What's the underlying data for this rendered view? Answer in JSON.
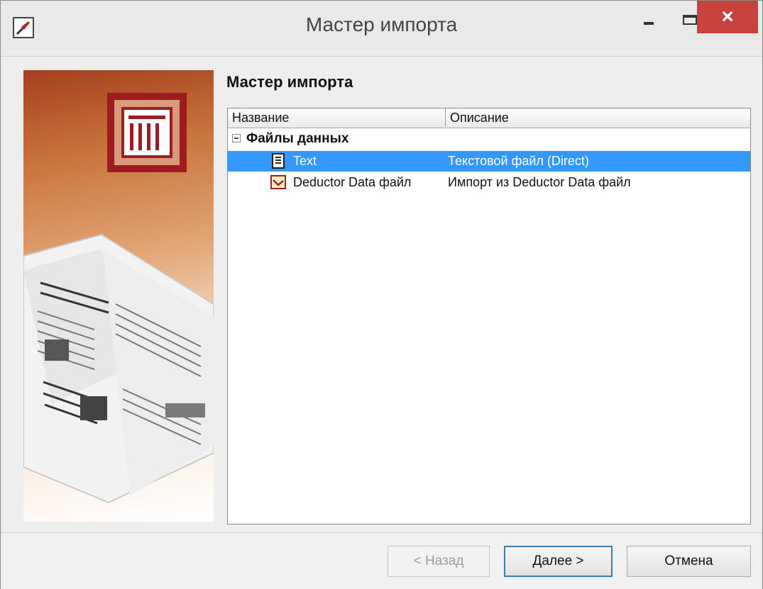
{
  "window": {
    "title": "Мастер импорта",
    "close_glyph": "×"
  },
  "panel": {
    "heading": "Мастер импорта"
  },
  "list": {
    "columns": [
      "Название",
      "Описание"
    ],
    "group": {
      "label": "Файлы данных",
      "expanded": true
    },
    "rows": [
      {
        "name": "Text",
        "description": "Текстовой файл (Direct)",
        "icon": "text-file-icon",
        "selected": true
      },
      {
        "name": "Deductor Data файл",
        "description": "Импорт из Deductor Data файл",
        "icon": "deductor-data-icon",
        "selected": false
      }
    ]
  },
  "buttons": {
    "back": "< Назад",
    "next": "Далее >",
    "cancel": "Отмена"
  },
  "colors": {
    "selection": "#3399ff",
    "close_button": "#c7423d",
    "banner_dark": "#a4401e"
  }
}
